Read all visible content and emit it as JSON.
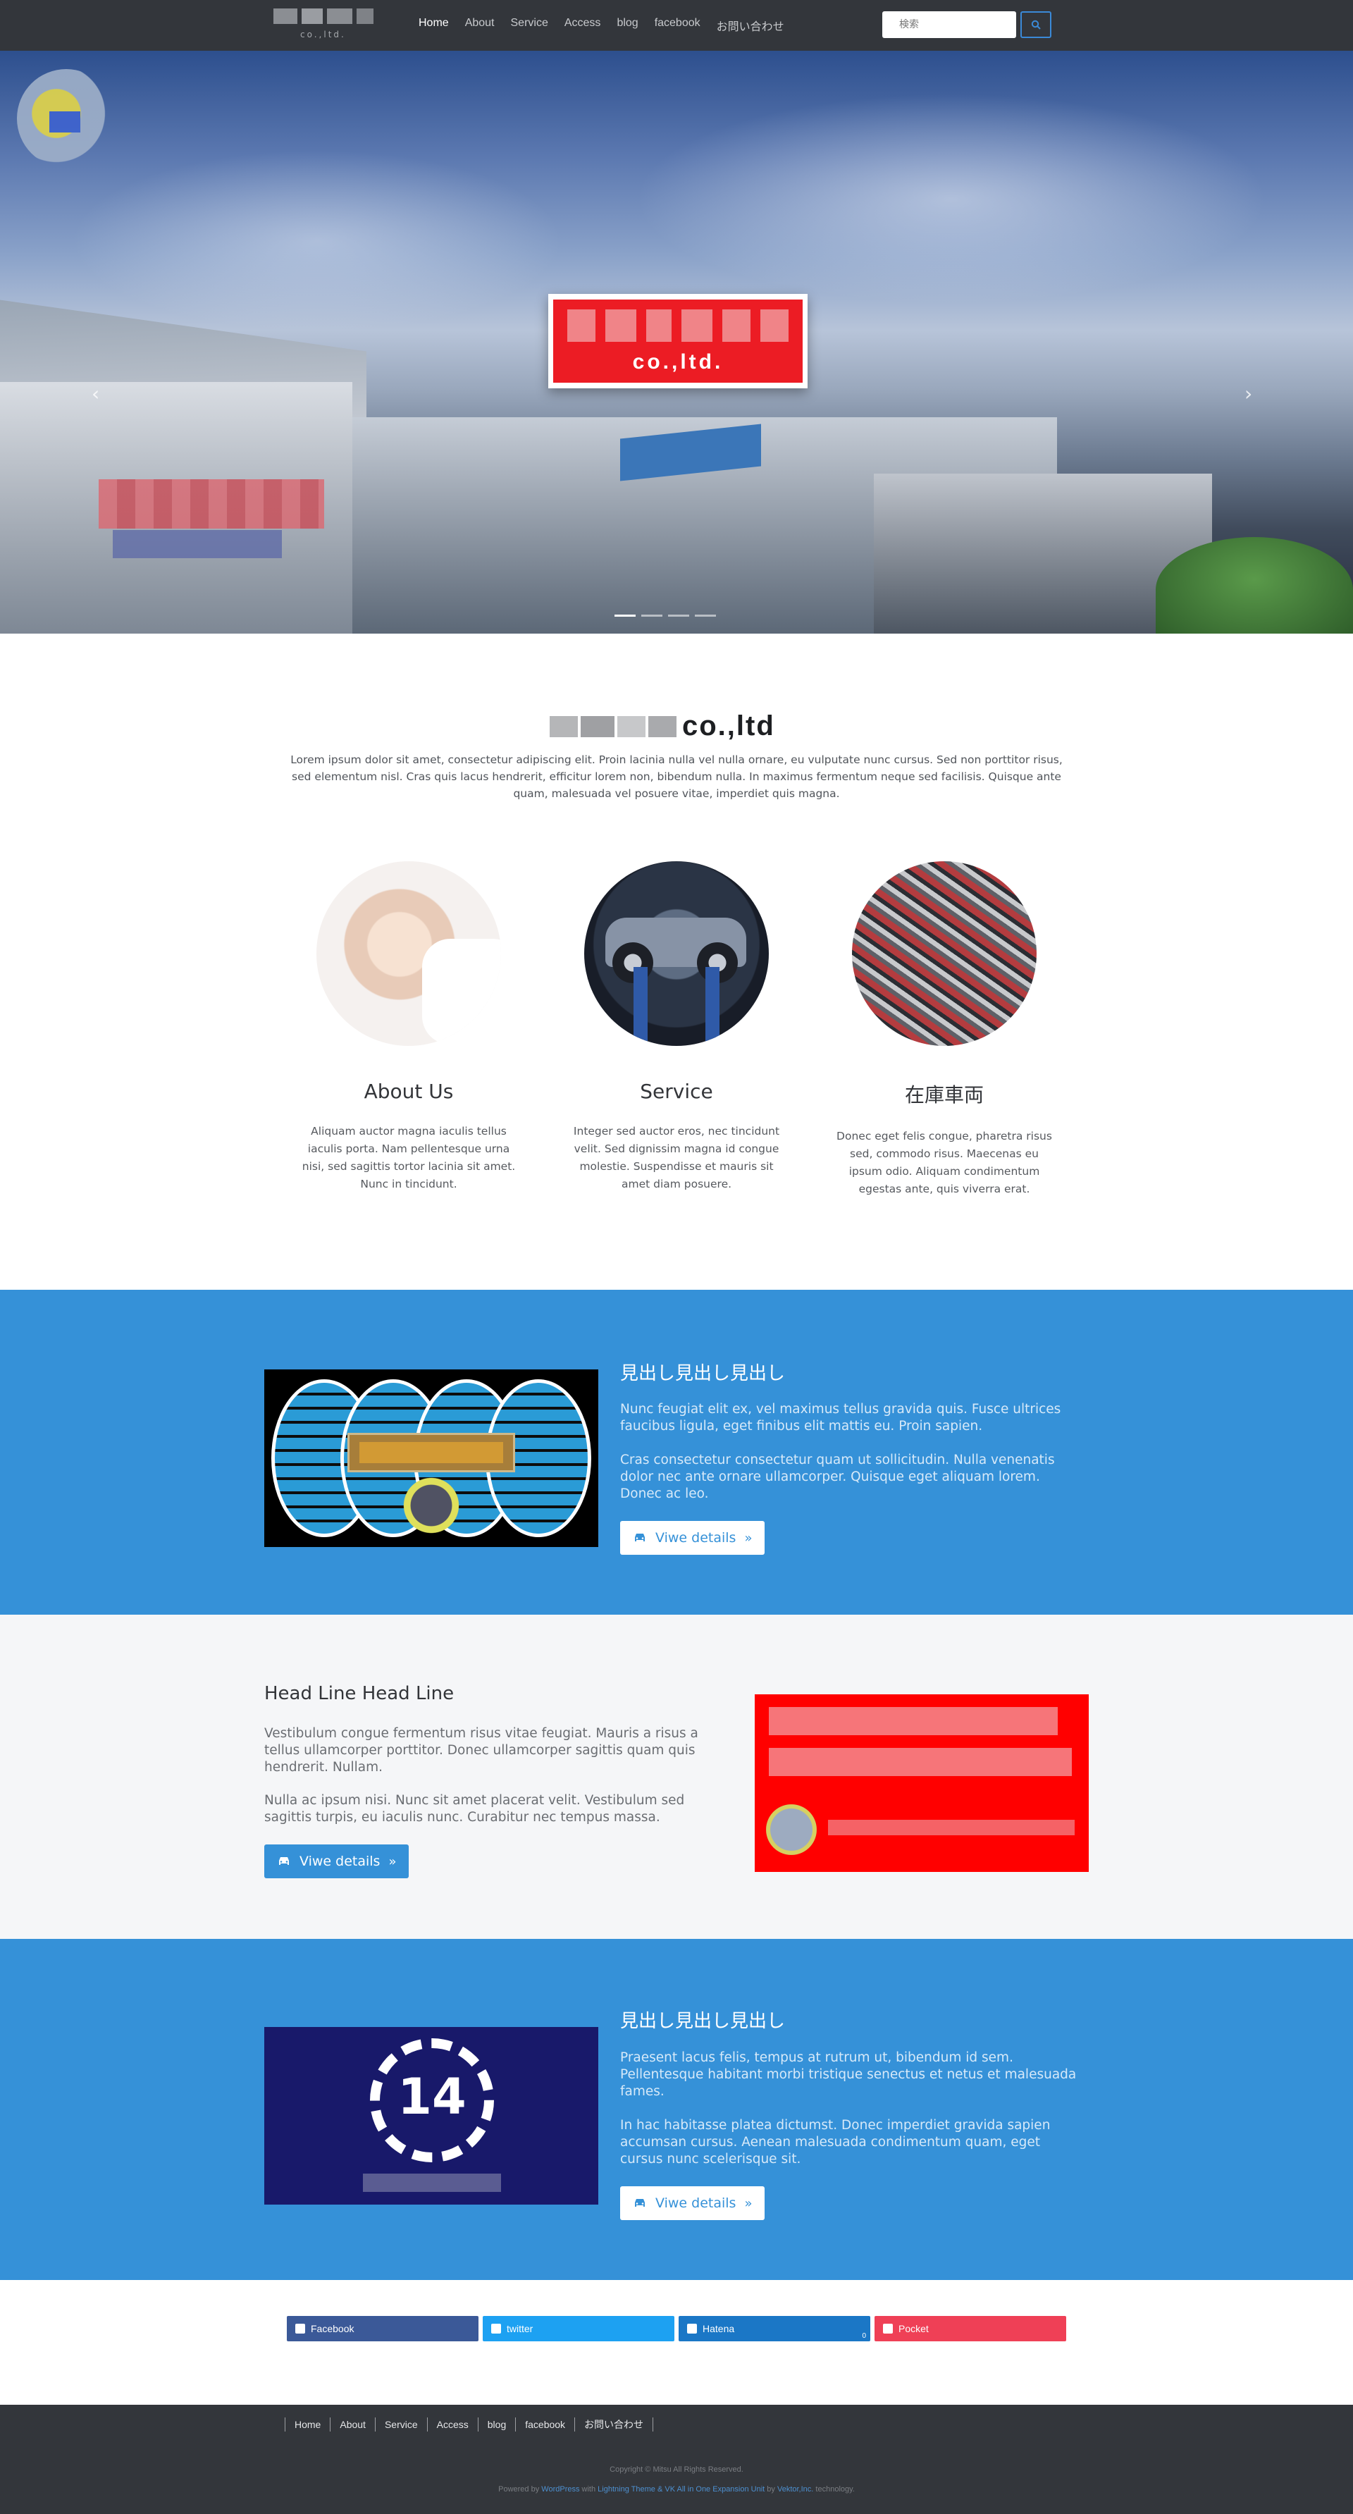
{
  "header": {
    "logo_sub": "co.,ltd.",
    "nav": [
      "Home",
      "About",
      "Service",
      "Access",
      "blog",
      "facebook",
      "お問い合わせ"
    ],
    "search_placeholder": "検索"
  },
  "hero": {
    "sign_text": "co.,ltd.",
    "slide_count": 4,
    "active_slide": 1
  },
  "intro": {
    "title": "co.,ltd",
    "text": "Lorem ipsum dolor sit amet, consectetur adipiscing elit. Proin lacinia nulla vel nulla ornare, eu vulputate nunc cursus. Sed non porttitor risus, sed elementum nisl. Cras quis lacus hendrerit, efficitur lorem non, bibendum nulla. In maximus fermentum neque sed facilisis. Quisque ante quam, malesuada vel posuere vitae, imperdiet quis magna."
  },
  "features": [
    {
      "title": "About Us",
      "text": "Aliquam auctor magna iaculis tellus iaculis porta. Nam pellentesque urna nisi, sed sagittis tortor lacinia sit amet. Nunc in tincidunt."
    },
    {
      "title": "Service",
      "text": "Integer sed auctor eros, nec tincidunt velit. Sed dignissim magna id congue molestie. Suspendisse et mauris sit amet diam posuere."
    },
    {
      "title": "在庫車両",
      "text": "Donec eget felis congue, pharetra risus sed, commodo risus. Maecenas eu ipsum odio. Aliquam condimentum egestas ante, quis viverra erat."
    }
  ],
  "section1": {
    "heading": "見出し見出し見出し",
    "p1": "Nunc feugiat elit ex, vel maximus tellus gravida quis. Fusce ultrices faucibus ligula, eget finibus elit mattis eu. Proin sapien.",
    "p2": "Cras consectetur consectetur quam ut sollicitudin. Nulla venenatis dolor nec ante ornare ullamcorper. Quisque eget aliquam lorem. Donec ac leo.",
    "button": "Viwe details"
  },
  "section2": {
    "heading": "Head Line Head Line",
    "p1": "Vestibulum congue fermentum risus vitae feugiat. Mauris a risus a tellus ullamcorper porttitor. Donec ullamcorper sagittis quam quis hendrerit. Nullam.",
    "p2": "Nulla ac ipsum nisi. Nunc sit amet placerat velit. Vestibulum sed sagittis turpis, eu iaculis nunc. Curabitur nec tempus massa.",
    "button": "Viwe details"
  },
  "section3": {
    "heading": "見出し見出し見出し",
    "badge_number": "14",
    "p1": "Praesent lacus felis, tempus at rutrum ut, bibendum id sem. Pellentesque habitant morbi tristique senectus et netus et malesuada fames.",
    "p2": "In hac habitasse platea dictumst. Donec imperdiet gravida sapien accumsan cursus. Aenean malesuada condimentum quam, eget cursus nunc scelerisque sit.",
    "button": "Viwe details"
  },
  "share": {
    "facebook": "Facebook",
    "twitter": "twitter",
    "hatena": "Hatena",
    "hatena_count": "0",
    "pocket": "Pocket"
  },
  "footer": {
    "nav": [
      "Home",
      "About",
      "Service",
      "Access",
      "blog",
      "facebook",
      "お問い合わせ"
    ],
    "copyright": "Copyright © Mitsu All Rights Reserved.",
    "powered_prefix": "Powered by",
    "powered_wp": "WordPress",
    "powered_with": "with",
    "powered_theme": "Lightning Theme & VK All in One Expansion Unit",
    "powered_by": "by",
    "powered_vektor": "Vektor,Inc.",
    "powered_suffix": "technology."
  },
  "colors": {
    "header_bg": "#33363b",
    "accent_blue": "#3591d8",
    "facebook": "#3b5998",
    "twitter": "#1da1f2",
    "hatena": "#1b77c6",
    "pocket": "#ef4056"
  },
  "icons": [
    "search-icon",
    "chevron-left-icon",
    "chevron-right-icon",
    "car-icon",
    "double-chevron-right-icon",
    "facebook-icon",
    "twitter-icon",
    "hatena-icon",
    "pocket-icon"
  ]
}
